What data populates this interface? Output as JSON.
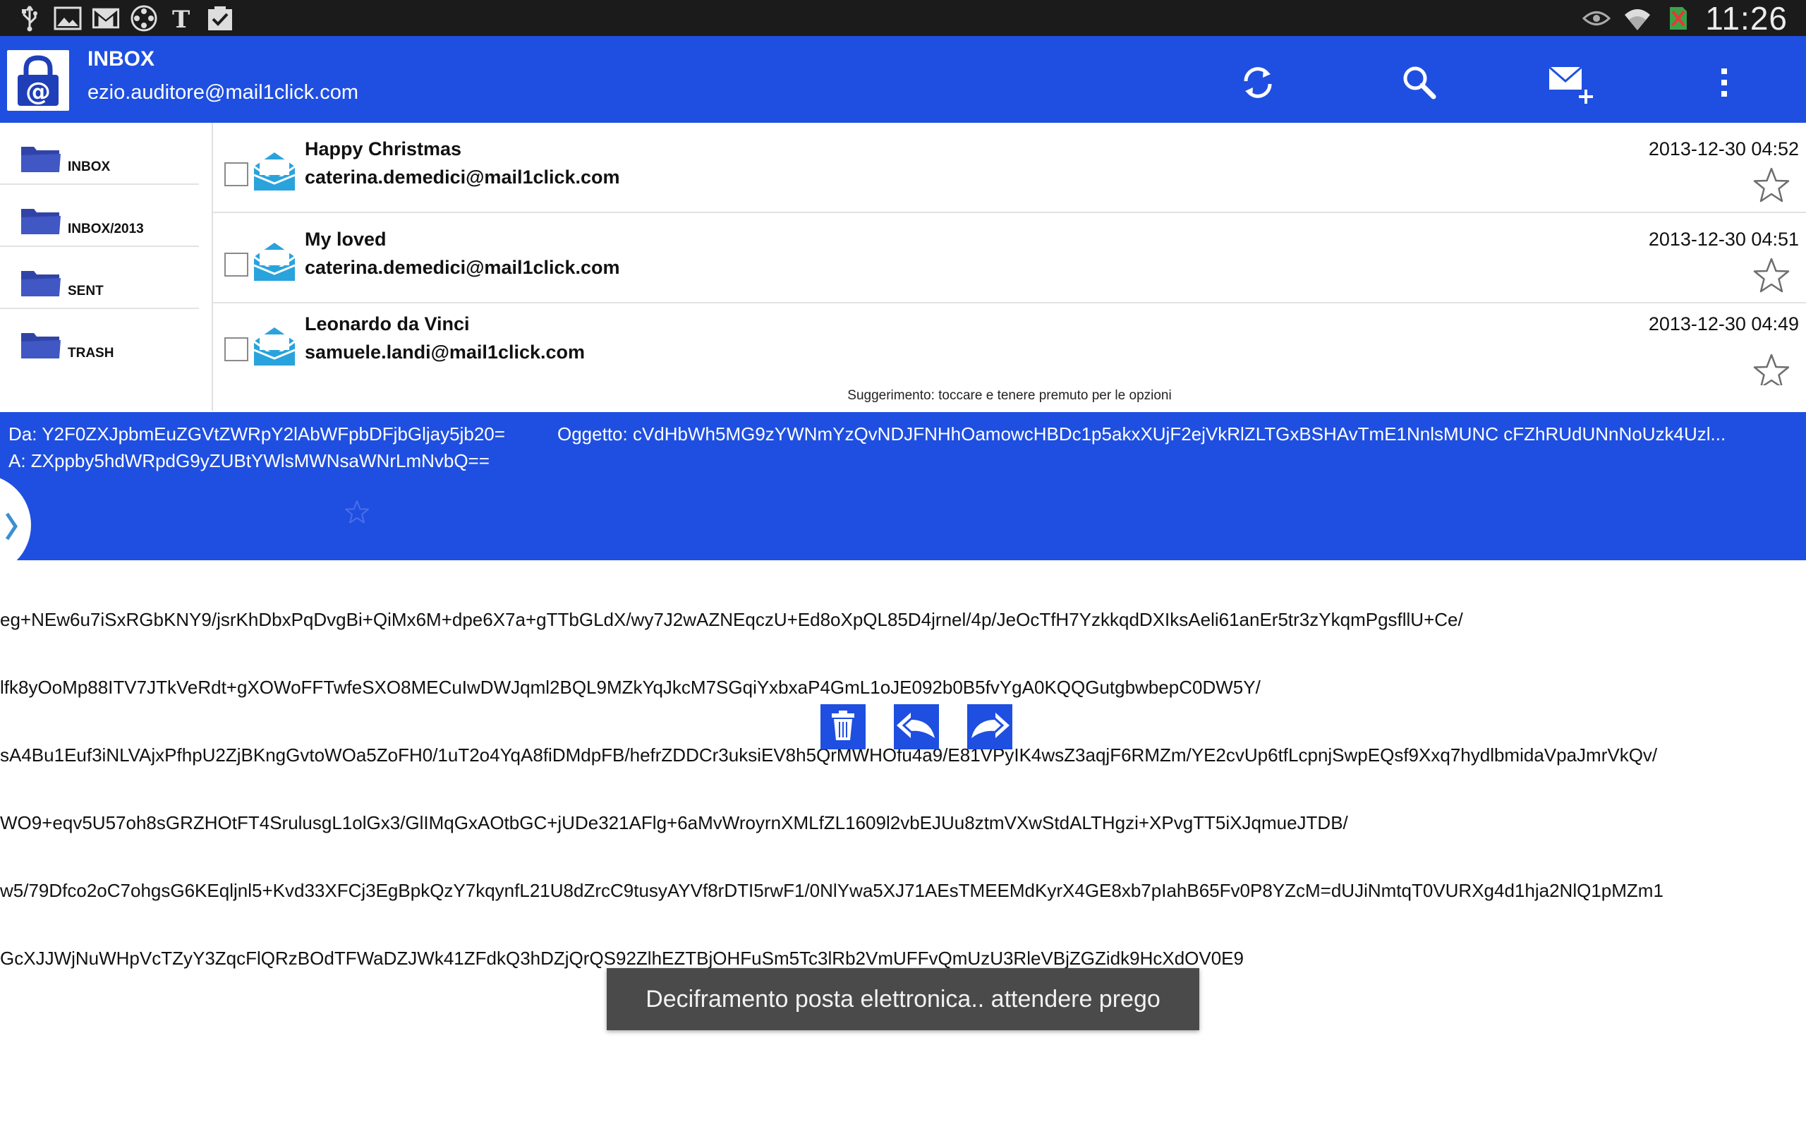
{
  "status_bar": {
    "time": "11:26",
    "left_icons": [
      "usb-icon",
      "gallery-icon",
      "gmail-icon",
      "film-reel-icon",
      "nyt-icon",
      "task-check-icon"
    ],
    "right_icons": [
      "eye-icon",
      "wifi-icon",
      "no-sim-icon",
      "battery-icon"
    ]
  },
  "action_bar": {
    "title": "INBOX",
    "account": "ezio.auditore@mail1click.com",
    "actions": [
      "refresh-icon",
      "search-icon",
      "compose-icon",
      "overflow-menu-icon"
    ]
  },
  "folders": [
    {
      "label": "INBOX"
    },
    {
      "label": "INBOX/2013"
    },
    {
      "label": "SENT"
    },
    {
      "label": "TRASH"
    }
  ],
  "messages": [
    {
      "subject": "Happy Christmas",
      "from": "caterina.demedici@mail1click.com",
      "date": "2013-12-30 04:52"
    },
    {
      "subject": "My loved",
      "from": "caterina.demedici@mail1click.com",
      "date": "2013-12-30 04:51"
    },
    {
      "subject": "Leonardo da Vinci",
      "from": "samuele.landi@mail1click.com",
      "date": "2013-12-30 04:49"
    }
  ],
  "hint": "Suggerimento: toccare e tenere premuto per le opzioni",
  "detail": {
    "from": "Da: Y2F0ZXJpbmEuZGVtZWRpY2lAbWFpbDFjbGljay5jb20=",
    "subject": "Oggetto: cVdHbWh5MG9zYWNmYzQvNDJFNHhOamowcHBDc1p5akxXUjF2ejVkRlZLTGxBSHAvTmE1NnlsMUNC cFZhRUdUNnNoUzk4Uzl...",
    "to": "A: ZXppby5hdWRpdG9yZUBtYWlsMWNsaWNrLmNvbQ=="
  },
  "body_lines": [
    "eg+NEw6u7iSxRGbKNY9/jsrKhDbxPqDvgBi+QiMx6M+dpe6X7a+gTTbGLdX/wy7J2wAZNEqczU+Ed8oXpQL85D4jrnel/4p/JeOcTfH7YzkkqdDXIksAeli61anEr5tr3zYkqmPgsfllU+Ce/",
    "lfk8yOoMp88ITV7JTkVeRdt+gXOWoFFTwfeSXO8MECuIwDWJqml2BQL9MZkYqJkcM7SGqiYxbxaP4GmL1oJE092b0B5fvYgA0KQQGutgbwbepC0DW5Y/",
    "sA4Bu1Euf3iNLVAjxPfhpU2ZjBKngGvtoWOa5ZoFH0/1uT2o4YqA8fiDMdpFB/hefrZDDCr3uksiEV8h5QrMWHOfu4a9/E81VPyIK4wsZ3aqjF6RMZm/YE2cvUp6tfLcpnjSwpEQsf9Xxq7hydlbmidaVpaJmrVkQv/",
    "WO9+eqv5U57oh8sGRZHOtFT4SrulusgL1olGx3/GlIMqGxAOtbGC+jUDe321AFlg+6aMvWroyrnXMLfZL1609l2vbEJUu8ztmVXwStdALTHgzi+XPvgTT5iXJqmueJTDB/",
    "w5/79Dfco2oC7ohgsG6KEqljnl5+Kvd33XFCj3EgBpkQzY7kqynfL21U8dZrcC9tusyAYVf8rDTI5rwF1/0NlYwa5XJ71AEsTMEEMdKyrX4GE8xb7pIahB65Fv0P8YZcM=dUJiNmtqT0VURXg4d1hja2NlQ1pMZm1",
    "GcXJJWjNuWHpVcTZyY3ZqcFlQRzBOdTFWaDZJWk41ZFdkQ3hDZjQrQS92ZlhEZTBjOHFuSm5Tc3lRb2VmUFFvQmUzU3RleVBjZGZidk9HcXdOV0E9"
  ],
  "toast": "Deciframento posta elettronica.. attendere prego",
  "colors": {
    "accent": "#1f4fe0",
    "folder": "#3044a8",
    "envelope": "#29a3dc"
  }
}
